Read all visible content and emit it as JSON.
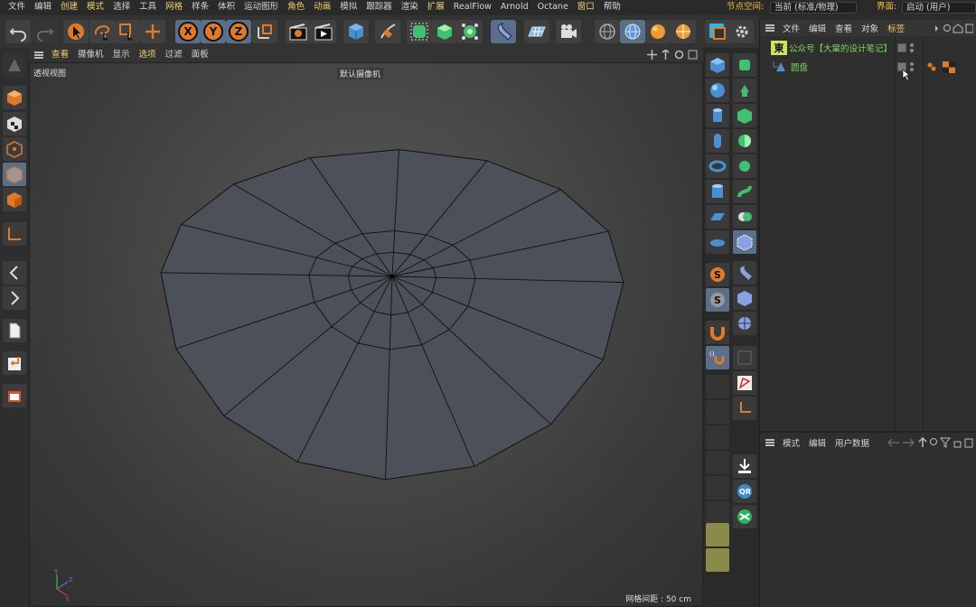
{
  "menubar": {
    "items": [
      {
        "label": "文件",
        "hl": false
      },
      {
        "label": "编辑",
        "hl": false
      },
      {
        "label": "创建",
        "hl": true
      },
      {
        "label": "模式",
        "hl": true
      },
      {
        "label": "选择",
        "hl": false
      },
      {
        "label": "工具",
        "hl": false
      },
      {
        "label": "网格",
        "hl": true
      },
      {
        "label": "样条",
        "hl": false
      },
      {
        "label": "体积",
        "hl": false
      },
      {
        "label": "运动图形",
        "hl": false
      },
      {
        "label": "角色",
        "hl": true
      },
      {
        "label": "动画",
        "hl": true
      },
      {
        "label": "模拟",
        "hl": false
      },
      {
        "label": "跟踪器",
        "hl": false
      },
      {
        "label": "渲染",
        "hl": false
      },
      {
        "label": "扩展",
        "hl": true
      },
      {
        "label": "RealFlow",
        "hl": false
      },
      {
        "label": "Arnold",
        "hl": false
      },
      {
        "label": "Octane",
        "hl": false
      },
      {
        "label": "窗口",
        "hl": true
      },
      {
        "label": "帮助",
        "hl": false
      }
    ],
    "nodes_label": "节点空间:",
    "nodes_value": "当前 (标准/物理)",
    "layout_label": "界面:",
    "layout_value": "启动 (用户)"
  },
  "toolbar": {
    "axis_x": "X",
    "axis_y": "Y",
    "axis_z": "Z"
  },
  "viewport": {
    "menu": [
      {
        "label": "查看",
        "hl": true
      },
      {
        "label": "摄像机",
        "hl": false
      },
      {
        "label": "显示",
        "hl": false
      },
      {
        "label": "选项",
        "hl": true
      },
      {
        "label": "过滤",
        "hl": false
      },
      {
        "label": "面板",
        "hl": false
      }
    ],
    "view_name": "透视视图",
    "camera_label": "默认摄像机",
    "grid_spacing": "网格间距 : 50 cm",
    "axis_x": "X",
    "axis_y": "Y",
    "axis_z": "Z"
  },
  "object_manager": {
    "menu": [
      {
        "label": "文件",
        "hl": false
      },
      {
        "label": "编辑",
        "hl": false
      },
      {
        "label": "查看",
        "hl": false
      },
      {
        "label": "对象",
        "hl": false
      },
      {
        "label": "标签",
        "hl": true
      }
    ],
    "objects": [
      {
        "name": "公众号【大窠的设计笔记】",
        "icon_text": "東",
        "color": "#80d060"
      },
      {
        "name": "圆盘",
        "icon_text": "",
        "color": "#80d060"
      }
    ]
  },
  "attribute_manager": {
    "menu": [
      {
        "label": "模式"
      },
      {
        "label": "编辑"
      },
      {
        "label": "用户数据"
      }
    ]
  },
  "colors": {
    "accent_orange": "#e07a2a",
    "highlight_blue": "#5a6f8a",
    "menu_highlight": "#f0d070",
    "object_green": "#80d060"
  }
}
